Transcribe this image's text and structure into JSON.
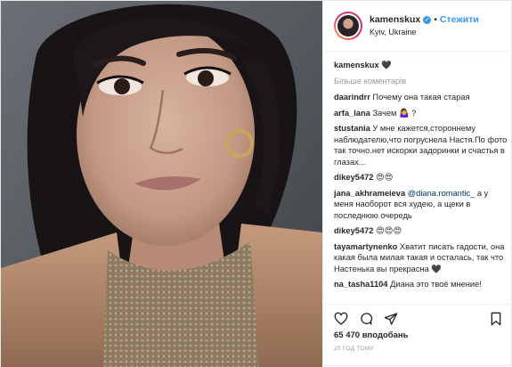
{
  "post": {
    "username": "kamenskux",
    "follow_separator": "•",
    "follow_label": "Стежити",
    "location": "Kyiv, Ukraine",
    "caption_user": "kamenskux",
    "caption_text": "🖤",
    "more_comments_label": "Більше коментарів",
    "comments": [
      {
        "user": "daarindrr",
        "text": "Почему она такая старая"
      },
      {
        "user": "arfa_lana",
        "text": "Зачем 🤷‍♀️ ?"
      },
      {
        "user": "stustania",
        "text": "У мне кажется,стороннему наблюдателю,что погруснела Настя.По фото так точно.нет искорки задоринки и счастья в глазах..."
      },
      {
        "user": "dikey5472",
        "text": "😍😍"
      },
      {
        "user": "jana_akhrameieva",
        "mention": "@diana.romantic_",
        "text": "а у меня наоборот вся худею, а щеки в последнюю очередь"
      },
      {
        "user": "dikey5472",
        "text": "😍😍😍"
      },
      {
        "user": "tayamartynenko",
        "text": "Хватит писать гадости, она какая была милая такая и осталась, так что Настенька вы прекрасна 🖤"
      },
      {
        "user": "na_tasha1104",
        "text": "Диана это твоё мнение!"
      }
    ],
    "likes_label": "65 470 вподобань",
    "time_label": "20 ГОД ТОМУ"
  },
  "icons": {
    "heart": "heart-icon",
    "comment": "comment-icon",
    "share": "share-icon",
    "bookmark": "bookmark-icon",
    "verified": "verified-badge-icon"
  },
  "colors": {
    "accent": "#3897f0",
    "muted": "#999999",
    "border": "#efefef"
  }
}
